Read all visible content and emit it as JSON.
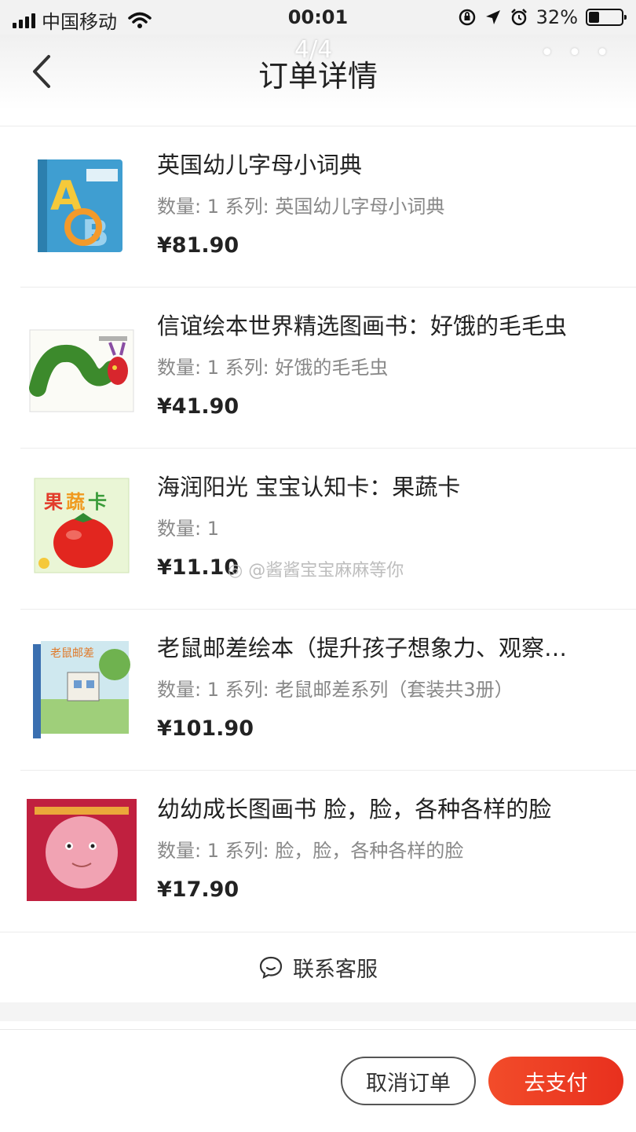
{
  "status_bar": {
    "carrier": "中国移动",
    "time": "00:01",
    "battery": "32%",
    "battery_level": 0.32,
    "icons": [
      "signal-icon",
      "wifi-icon",
      "orientation-lock-icon",
      "location-icon",
      "alarm-icon",
      "battery-icon"
    ]
  },
  "nav": {
    "title": "订单详情",
    "pager": "4/4",
    "more": "• • •",
    "back_icon": "chevron-left-icon"
  },
  "items": [
    {
      "name": "英国幼儿字母小词典",
      "meta": "数量: 1 系列: 英国幼儿字母小词典",
      "price": "¥81.90"
    },
    {
      "name": "信谊绘本世界精选图画书：好饿的毛毛虫",
      "meta": "数量: 1 系列: 好饿的毛毛虫",
      "price": "¥41.90"
    },
    {
      "name": "海润阳光 宝宝认知卡：果蔬卡",
      "meta": "数量: 1",
      "price": "¥11.10"
    },
    {
      "name": "老鼠邮差绘本（提升孩子想象力、观察…",
      "meta": "数量: 1 系列: 老鼠邮差系列（套装共3册）",
      "price": "¥101.90"
    },
    {
      "name": "幼幼成长图画书 脸，脸，各种各样的脸",
      "meta": "数量: 1 系列: 脸，脸，各种各样的脸",
      "price": "¥17.90"
    }
  ],
  "watermark": "@酱酱宝宝麻麻等你",
  "contact": {
    "label": "联系客服",
    "icon": "chat-bubble-icon"
  },
  "actions": {
    "cancel": "取消订单",
    "pay": "去支付"
  },
  "colors": {
    "accent": "#e8341f",
    "text": "#222222",
    "muted": "#888888"
  }
}
